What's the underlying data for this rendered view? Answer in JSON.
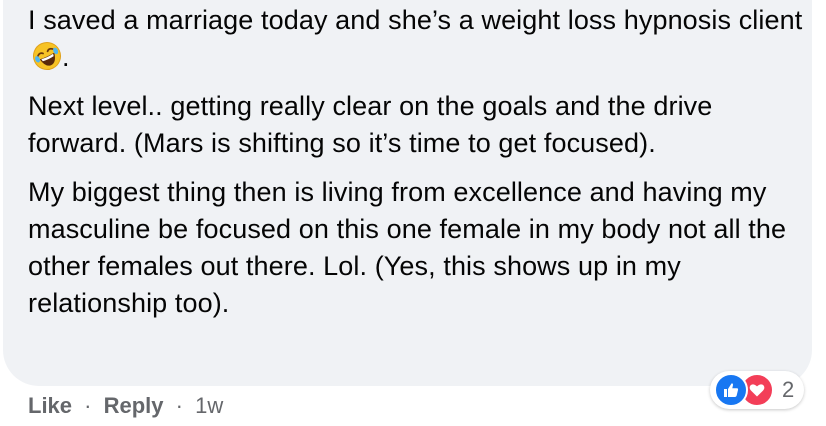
{
  "comment": {
    "paragraphs": [
      "I saved a marriage today and she’s a weight loss hypnosis client",
      "Next level.. getting really clear on the goals and the drive forward. (Mars is shifting so it’s time to get focused).",
      "My biggest thing then is living from excellence and having my masculine be focused on this one female in my body not all the other females out there. Lol. (Yes, this shows up in my relationship too)."
    ],
    "first_paragraph_suffix": ".",
    "emoji": "rolling-on-floor-laughing-icon"
  },
  "actions": {
    "like_label": "Like",
    "separator": "·",
    "reply_label": "Reply",
    "time": "1w"
  },
  "reactions": {
    "icons": [
      "like-icon",
      "love-icon"
    ],
    "count": "2",
    "colors": {
      "like": "#1877f2",
      "love": "#f33e58"
    }
  },
  "colors": {
    "bubble": "#f0f2f5",
    "text": "#050505",
    "secondary_text": "#65676b"
  }
}
